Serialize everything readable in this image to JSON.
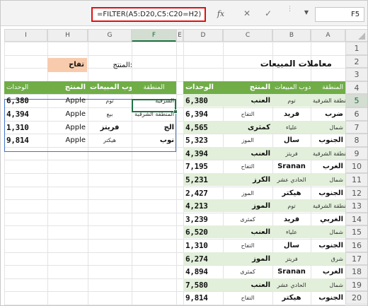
{
  "formula_bar": {
    "formula": "=FILTER(A5:D20,C5:C20=H2)",
    "fx_label": "fx",
    "cancel_glyph": "✕",
    "enter_glyph": "✓",
    "name_box": "F5"
  },
  "columns": [
    "A",
    "B",
    "C",
    "D",
    "E",
    "F",
    "G",
    "H",
    "I"
  ],
  "selected_column": "F",
  "rows": [
    "1",
    "2",
    "3",
    "4",
    "5",
    "6",
    "7",
    "8",
    "9",
    "10",
    "11",
    "12",
    "13",
    "14",
    "15",
    "16",
    "17",
    "18",
    "19",
    "20"
  ],
  "selected_row": "5",
  "title": "معاملات المبيعات",
  "filter": {
    "label": "المنتج:",
    "value": "تفاح"
  },
  "source_table": {
    "headers": [
      "المنطقة",
      "مندوب المبيعات",
      "المنتج",
      "الوحدات"
    ],
    "rows": [
      [
        "المنطقة الشرقية",
        "توم",
        "العنب",
        "6,380"
      ],
      [
        "ضرب",
        "فريد",
        "التفاح",
        "6,394"
      ],
      [
        "شمال",
        "علياء",
        "كمثرى",
        "4,565"
      ],
      [
        "الجنوب",
        "سال",
        "الموز",
        "5,323"
      ],
      [
        "المنطقة الشرقية",
        "فريتز",
        "العنب",
        "4,394"
      ],
      [
        "الغرب",
        "Sranan",
        "التفاح",
        "7,195"
      ],
      [
        "شمال",
        "الحادي عشر",
        "الكرز",
        "5,231"
      ],
      [
        "الجنوب",
        "هيكتر",
        "الموز",
        "2,427"
      ],
      [
        "المنطقة الشرقية",
        "توم",
        "الموز",
        "4,213"
      ],
      [
        "الغربي",
        "فريد",
        "كمثرى",
        "3,239"
      ],
      [
        "شمال",
        "علياء",
        "العنب",
        "6,520"
      ],
      [
        "الجنوب",
        "سال",
        "التفاح",
        "1,310"
      ],
      [
        "شرق",
        "فريتز",
        "الموز",
        "6,274"
      ],
      [
        "الغرب",
        "Sranan",
        "كمثرى",
        "4,894"
      ],
      [
        "شمال",
        "الحادي عشر",
        "العنب",
        "7,580"
      ],
      [
        "الجنوب",
        "هيكتر",
        "التفاح",
        "9,814"
      ]
    ]
  },
  "result_table": {
    "headers": [
      "المنطقة",
      "مندوب المبيعات",
      "المنتج",
      "الوحدات"
    ],
    "rows": [
      [
        "الشرقية",
        "توم",
        "Apple",
        "6,380"
      ],
      [
        "المنطقة الشرقية",
        "بيع",
        "Apple",
        "4,394"
      ],
      [
        "الج",
        "فريتز",
        "Apple",
        "1,310"
      ],
      [
        "نوب",
        "هيكتر",
        "Apple",
        "9,814"
      ]
    ]
  }
}
